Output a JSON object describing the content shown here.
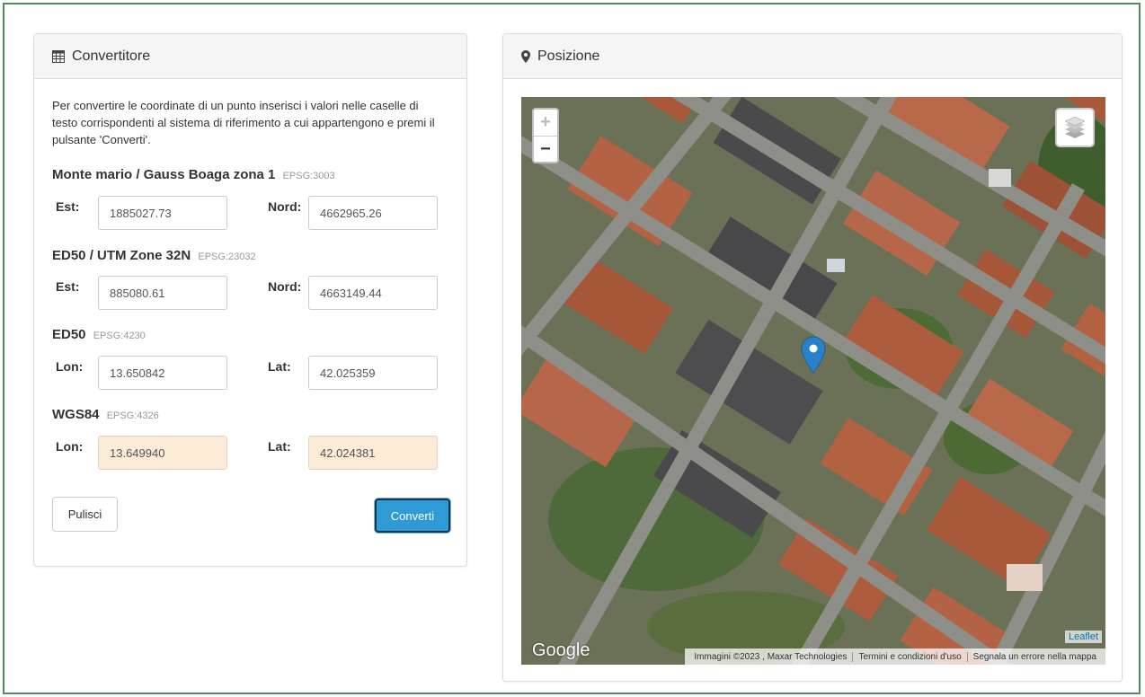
{
  "converter": {
    "title": "Convertitore",
    "intro": "Per convertire le coordinate di un punto inserisci i valori nelle caselle di testo corrispondenti al sistema di riferimento a cui appartengono e premi il pulsante 'Converti'.",
    "systems": [
      {
        "name": "Monte mario / Gauss Boaga zona 1",
        "epsg": "EPSG:3003",
        "label1": "Est:",
        "value1": "1885027.73",
        "label2": "Nord:",
        "value2": "4662965.26"
      },
      {
        "name": "ED50 / UTM Zone 32N",
        "epsg": "EPSG:23032",
        "label1": "Est:",
        "value1": "885080.61",
        "label2": "Nord:",
        "value2": "4663149.44"
      },
      {
        "name": "ED50",
        "epsg": "EPSG:4230",
        "label1": "Lon:",
        "value1": "13.650842",
        "label2": "Lat:",
        "value2": "42.025359"
      },
      {
        "name": "WGS84",
        "epsg": "EPSG:4326",
        "label1": "Lon:",
        "value1": "13.649940",
        "label2": "Lat:",
        "value2": "42.024381"
      }
    ],
    "clear_label": "Pulisci",
    "convert_label": "Converti"
  },
  "position": {
    "title": "Posizione",
    "zoom_in": "+",
    "zoom_out": "−",
    "leaflet": "Leaflet",
    "google": "Google",
    "attribution": [
      "Immagini ©2023 , Maxar Technologies",
      "Termini e condizioni d'uso",
      "Segnala un errore nella mappa"
    ]
  },
  "icons": {
    "calculator": "calculator-icon",
    "map_marker": "map-marker-icon",
    "layers": "layers-icon",
    "pin": "location-pin-icon"
  },
  "colors": {
    "frame_border": "#4e8a5a",
    "result_field_bg": "#fcebd5",
    "convert_button": "#2e9ad6",
    "marker": "#2a81cb"
  }
}
